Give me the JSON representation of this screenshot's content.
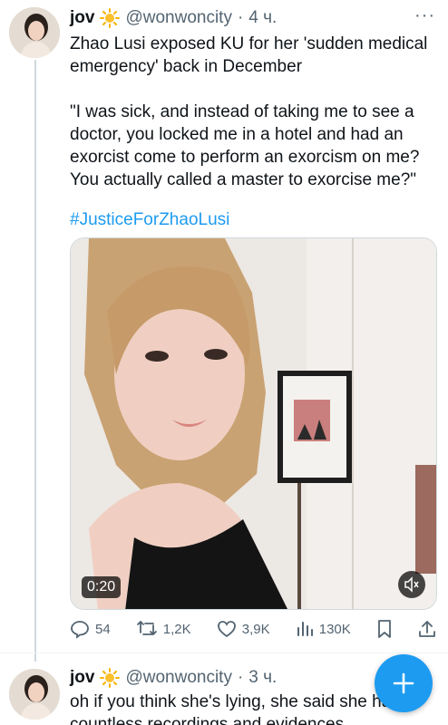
{
  "tweet1": {
    "author": "jov",
    "handle": "@wonwoncity",
    "separator": "·",
    "time": "4 ч.",
    "text": "Zhao Lusi exposed KU for her 'sudden medical emergency' back in December\n\n\"I was sick, and instead of taking me to see a doctor, you locked me in a hotel and had an exorcist come to perform an exorcism on me? You actually called a master to exorcise me?\"",
    "hashtag": "#JusticeForZhaoLusi",
    "video_duration": "0:20",
    "stats": {
      "replies": "54",
      "retweets": "1,2K",
      "likes": "3,9K",
      "views": "130K"
    }
  },
  "tweet2": {
    "author": "jov",
    "handle": "@wonwoncity",
    "separator": "·",
    "time": "3 ч.",
    "text": "oh if you think she's lying, she said she has countless recordings and evidences"
  },
  "colors": {
    "accent": "#1d9bf0",
    "secondary_text": "#536471",
    "primary_text": "#0f1419"
  },
  "icons": [
    "sun-emoji-icon",
    "more-icon",
    "reply-icon",
    "retweet-icon",
    "like-icon",
    "views-icon",
    "bookmark-icon",
    "share-icon",
    "mute-icon",
    "compose-icon"
  ]
}
